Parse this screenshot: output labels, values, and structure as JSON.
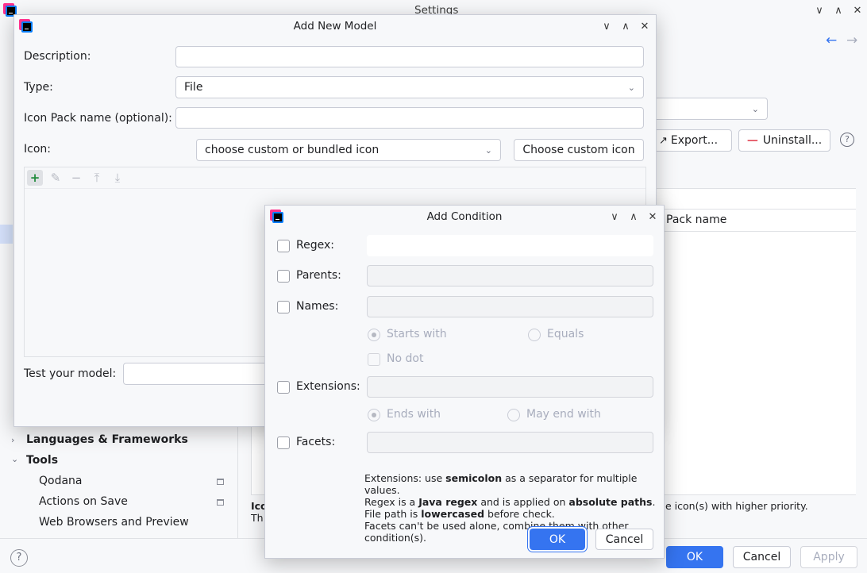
{
  "settings": {
    "title": "Settings",
    "export_label": "Export...",
    "uninstall_label": "Uninstall...",
    "column_pack_name": "Pack name",
    "tree": {
      "languages": "Languages & Frameworks",
      "tools": "Tools",
      "qodana": "Qodana",
      "actions_on_save": "Actions on Save",
      "web_browsers": "Web Browsers and Preview"
    },
    "bottom_text_1": "Ico",
    "bottom_text_2": "Th",
    "priority_text": "e icon(s) with higher priority.",
    "ok_label": "OK",
    "cancel_label": "Cancel",
    "apply_label": "Apply",
    "help_glyph": "?"
  },
  "add_model": {
    "title": "Add New Model",
    "description_label": "Description:",
    "type_label": "Type:",
    "type_value": "File",
    "icon_pack_label": "Icon Pack name (optional):",
    "icon_label": "Icon:",
    "icon_combo_value": "choose custom or bundled icon",
    "choose_custom_label": "Choose custom icon",
    "test_label": "Test your model:"
  },
  "add_condition": {
    "title": "Add Condition",
    "regex_label": "Regex:",
    "parents_label": "Parents:",
    "names_label": "Names:",
    "starts_with_label": "Starts with",
    "equals_label": "Equals",
    "no_dot_label": "No dot",
    "extensions_label": "Extensions:",
    "ends_with_label": "Ends with",
    "may_end_with_label": "May end with",
    "facets_label": "Facets:",
    "notes": {
      "l1a": "Extensions: use ",
      "l1b": "semicolon",
      "l1c": " as a separator for multiple values.",
      "l2a": "Regex is a ",
      "l2b": "Java regex",
      "l2c": " and is applied on ",
      "l2d": "absolute paths",
      "l2e": ".",
      "l3a": "File path is ",
      "l3b": "lowercased",
      "l3c": " before check.",
      "l4": "Facets can't be used alone, combine them with other condition(s)."
    },
    "ok_label": "OK",
    "cancel_label": "Cancel"
  },
  "colors": {
    "accent": "#3574f0",
    "add_icon": "#208a3c",
    "uninstall_icon": "#e55765"
  }
}
